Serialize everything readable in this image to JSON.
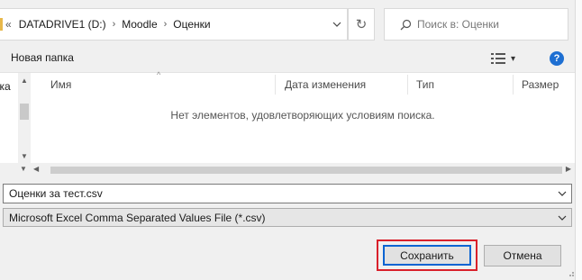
{
  "address_bar": {
    "overflow_chevron": "«",
    "crumbs": [
      "DATADRIVE1 (D:)",
      "Moodle",
      "Оценки"
    ],
    "separator": "›",
    "dropdown_glyph": "⌄"
  },
  "refresh_glyph": "↻",
  "search": {
    "placeholder": "Поиск в: Оценки"
  },
  "toolbar": {
    "new_folder": "Новая папка",
    "view_dropdown_glyph": "▾",
    "help": "?"
  },
  "nav_pane": {
    "clipped_text": "зка"
  },
  "columns": {
    "name": "Имя",
    "date_modified": "Дата изменения",
    "type": "Тип",
    "size": "Размер",
    "sort_caret": "^"
  },
  "empty_message": "Нет элементов, удовлетворяющих условиям поиска.",
  "scroll": {
    "up": "▲",
    "down": "▼",
    "left": "◀",
    "right": "▶"
  },
  "file_name": {
    "value": "Оценки за тест.csv",
    "dropdown_glyph": "⌄"
  },
  "file_type": {
    "value": "Microsoft Excel Comma Separated Values File (*.csv)",
    "dropdown_glyph": "⌄"
  },
  "buttons": {
    "save": "Сохранить",
    "cancel": "Отмена"
  },
  "colors": {
    "accent": "#0a64d2",
    "highlight": "#d9202b",
    "help": "#1e6fd2"
  }
}
